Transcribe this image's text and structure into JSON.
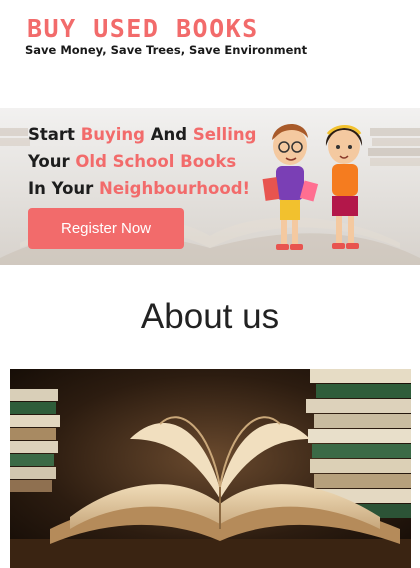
{
  "header": {
    "brand": "BUY USED BOOKS",
    "tagline": "Save Money, Save Trees, Save Environment"
  },
  "hero": {
    "line1": [
      {
        "text": "Start ",
        "hl": false
      },
      {
        "text": "Buying",
        "hl": true
      },
      {
        "text": " And ",
        "hl": false
      },
      {
        "text": "Selling",
        "hl": true
      }
    ],
    "line2": [
      {
        "text": "Your ",
        "hl": false
      },
      {
        "text": "Old School Books",
        "hl": true
      }
    ],
    "line3": [
      {
        "text": "In Your ",
        "hl": false
      },
      {
        "text": "Neighbourhood!",
        "hl": true
      }
    ],
    "register_label": "Register Now"
  },
  "about": {
    "title": "About us"
  },
  "colors": {
    "accent": "#f26b6b",
    "text": "#1d1d1d"
  },
  "icons": {
    "hero_illustration": "kids-with-books-illustration",
    "about_image": "open-book-photo"
  }
}
